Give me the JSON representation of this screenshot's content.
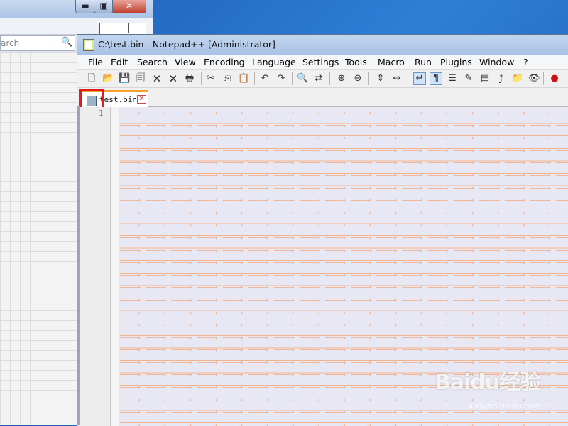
{
  "background_window": {
    "search_placeholder": "arch",
    "search_icon": "magnifier-icon",
    "minimize_glyph": "▬",
    "maximize_glyph": "▣",
    "close_glyph": "✕"
  },
  "window": {
    "title": "C:\\test.bin - Notepad++ [Administrator]",
    "icon": "notepadpp-app-icon"
  },
  "menu": {
    "items": [
      "File",
      "Edit",
      "Search",
      "View",
      "Encoding",
      "Language",
      "Settings",
      "Tools",
      "Macro",
      "Run",
      "Plugins",
      "Window",
      "?"
    ]
  },
  "toolbar": {
    "buttons": [
      {
        "name": "new-file-icon",
        "glyph": "🗋"
      },
      {
        "name": "open-file-icon",
        "glyph": "📂"
      },
      {
        "name": "save-icon",
        "glyph": "💾"
      },
      {
        "name": "save-all-icon",
        "glyph": "🗐"
      },
      {
        "name": "close-icon",
        "glyph": "🗙"
      },
      {
        "name": "close-all-icon",
        "glyph": "🗙"
      },
      {
        "name": "print-icon",
        "glyph": "🖶"
      },
      {
        "name": "cut-icon",
        "glyph": "✂"
      },
      {
        "name": "copy-icon",
        "glyph": "⎘"
      },
      {
        "name": "paste-icon",
        "glyph": "📋"
      },
      {
        "name": "undo-icon",
        "glyph": "↶"
      },
      {
        "name": "redo-icon",
        "glyph": "↷"
      },
      {
        "name": "find-icon",
        "glyph": "🔍"
      },
      {
        "name": "replace-icon",
        "glyph": "⇄"
      },
      {
        "name": "zoom-in-icon",
        "glyph": "⊕"
      },
      {
        "name": "zoom-out-icon",
        "glyph": "⊖"
      },
      {
        "name": "sync-vertical-icon",
        "glyph": "⇕"
      },
      {
        "name": "sync-horizontal-icon",
        "glyph": "⇔"
      },
      {
        "name": "word-wrap-icon",
        "glyph": "↵"
      },
      {
        "name": "show-all-chars-icon",
        "glyph": "¶"
      },
      {
        "name": "indent-guide-icon",
        "glyph": "☰"
      },
      {
        "name": "udl-icon",
        "glyph": "✎"
      },
      {
        "name": "doc-map-icon",
        "glyph": "▤"
      },
      {
        "name": "function-list-icon",
        "glyph": "ƒ"
      },
      {
        "name": "folder-workspace-icon",
        "glyph": "📁"
      },
      {
        "name": "monitoring-icon",
        "glyph": "👁"
      },
      {
        "name": "record-macro-icon",
        "glyph": "●"
      },
      {
        "name": "stop-macro-icon",
        "glyph": "■"
      }
    ],
    "active": [
      "word-wrap-icon",
      "show-all-chars-icon"
    ]
  },
  "tabs": [
    {
      "label": "test.bin",
      "icon": "save-state-icon",
      "close_glyph": "✕"
    }
  ],
  "editor": {
    "line_number": "1",
    "tab_arrow": "———→"
  },
  "watermark": {
    "text": "Baidu经验",
    "sub": "jingyan.baidu.com"
  },
  "colors": {
    "highlight": "#e01c1c",
    "editor_bg": "#e8e8f4",
    "tab_arrow": "#f2a77a",
    "active_tab_top": "#f7a12b"
  }
}
